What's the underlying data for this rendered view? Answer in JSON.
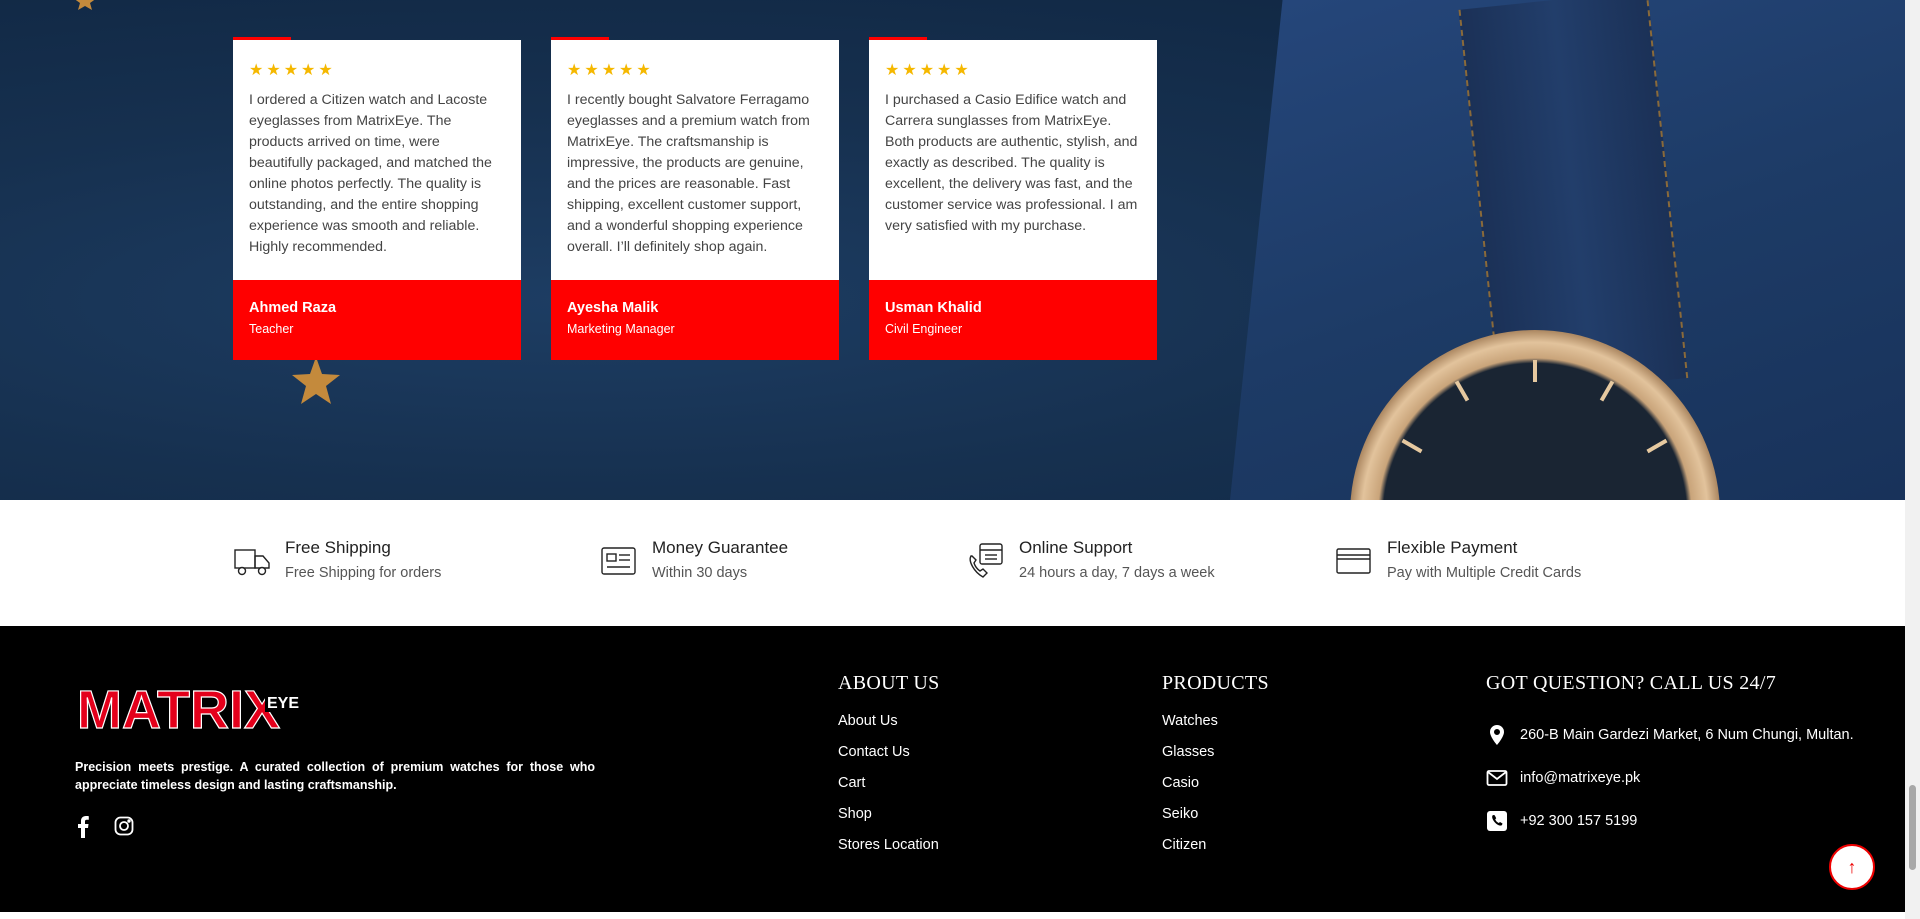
{
  "testimonials": [
    {
      "stars": "★★★★★",
      "text": "I ordered a Citizen watch and Lacoste eyeglasses from MatrixEye. The products arrived on time, were beautifully packaged, and matched the online photos perfectly. The quality is outstanding, and the entire shopping experience was smooth and reliable. Highly recommended.",
      "name": "Ahmed Raza",
      "role": "Teacher"
    },
    {
      "stars": "★★★★★",
      "text": "I recently bought Salvatore Ferragamo eyeglasses and a premium watch from MatrixEye. The craftsmanship is impressive, the products are genuine, and the prices are reasonable. Fast shipping, excellent customer support, and a wonderful shopping experience overall. I’ll definitely shop again.",
      "name": "Ayesha Malik",
      "role": "Marketing Manager"
    },
    {
      "stars": "★★★★★",
      "text": "I purchased a Casio Edifice watch and Carrera sunglasses from MatrixEye. Both products are authentic, stylish, and exactly as described. The quality is excellent, the delivery was fast, and the customer service was professional. I am very satisfied with my purchase.",
      "name": "Usman Khalid",
      "role": "Civil Engineer"
    }
  ],
  "features": [
    {
      "icon": "truck-icon",
      "title": "Free Shipping",
      "subtitle": "Free Shipping for orders"
    },
    {
      "icon": "money-card-icon",
      "title": "Money Guarantee",
      "subtitle": "Within 30 days"
    },
    {
      "icon": "support-phone-icon",
      "title": "Online Support",
      "subtitle": "24 hours a day, 7 days a week"
    },
    {
      "icon": "credit-card-icon",
      "title": "Flexible Payment",
      "subtitle": "Pay with Multiple Credit Cards"
    }
  ],
  "footer": {
    "logo_main": "MATRIX",
    "logo_sub": "EYE",
    "description": "Precision meets prestige. A curated collection of premium watches for those who appreciate timeless design and lasting craftsmanship.",
    "social": [
      "facebook-icon",
      "instagram-icon"
    ],
    "about": {
      "heading": "ABOUT US",
      "links": [
        "About Us",
        "Contact Us",
        "Cart",
        "Shop",
        "Stores Location"
      ]
    },
    "products": {
      "heading": "PRODUCTS",
      "links": [
        "Watches",
        "Glasses",
        "Casio",
        "Seiko",
        "Citizen"
      ]
    },
    "contact": {
      "heading": "GOT QUESTION? CALL US 24/7",
      "address": "260-B Main Gardezi Market, 6 Num Chungi, Multan.",
      "email": "info@matrixeye.pk",
      "phone": "+92 300 157 5199"
    },
    "scroll_top_icon": "↑"
  },
  "colors": {
    "accent": "#ff0000",
    "star": "#f5b800",
    "hero_bg": "#16304f",
    "footer_bg": "#000000"
  }
}
